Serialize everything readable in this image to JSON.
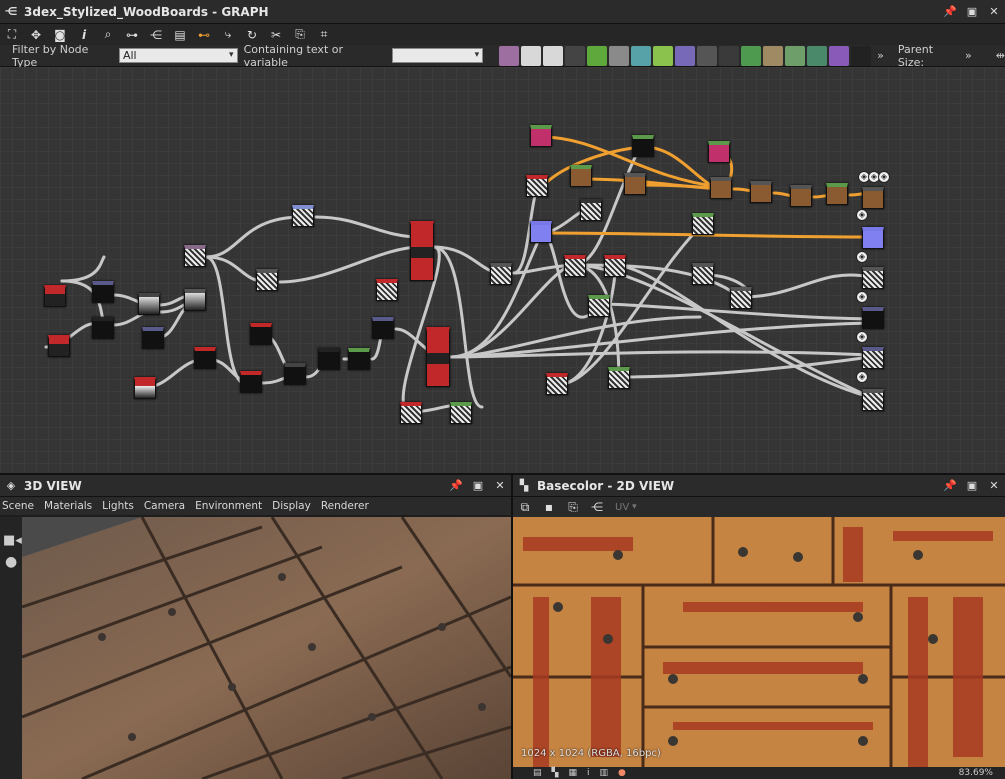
{
  "graph_panel": {
    "title": "3dex_Stylized_WoodBoards - GRAPH",
    "filter_label": "Filter by Node Type",
    "filter_value": "All",
    "containing_label": "Containing text or variable",
    "containing_value": "",
    "parent_size_label": "Parent Size:",
    "overflow_glyph": "»",
    "toolbar_icons": [
      "frame-icon",
      "pan-icon",
      "camera-icon",
      "info-icon",
      "search-icon",
      "link-icon",
      "hierarchy-icon",
      "layers-icon",
      "connect-icon",
      "route-icon",
      "refresh-icon",
      "tools-icon",
      "export-icon",
      "crop-icon"
    ],
    "filter_icons": [
      {
        "name": "image-filter-icon",
        "color": "#9c6fa0"
      },
      {
        "name": "blend-filter-icon",
        "color": "#d8d8d8"
      },
      {
        "name": "levels-filter-icon",
        "color": "#d8d8d8"
      },
      {
        "name": "shuffle-filter-icon",
        "color": "#444444"
      },
      {
        "name": "curve-filter-icon",
        "color": "#5ea83c"
      },
      {
        "name": "color-filter-icon",
        "color": "#8a8a8a"
      },
      {
        "name": "transform-filter-icon",
        "color": "#56a2a8"
      },
      {
        "name": "gradient-filter-icon",
        "color": "#8bc24e"
      },
      {
        "name": "hsl-filter-icon",
        "color": "#7868b8"
      },
      {
        "name": "grid-filter-icon",
        "color": "#555555"
      },
      {
        "name": "output-filter-icon",
        "color": "#3a3a3a"
      },
      {
        "name": "fx-filter-icon",
        "color": "#4e9a4e"
      },
      {
        "name": "normal-filter-icon",
        "color": "#a08a64"
      },
      {
        "name": "hue-filter-icon",
        "color": "#6e9e6a"
      },
      {
        "name": "sharpen-filter-icon",
        "color": "#4a8a6a"
      },
      {
        "name": "spectral-filter-icon",
        "color": "#8a5ab8"
      },
      {
        "name": "noise-filter-icon",
        "color": "#222222"
      }
    ]
  },
  "view3d": {
    "title": "3D VIEW",
    "menu": [
      "Scene",
      "Materials",
      "Lights",
      "Camera",
      "Environment",
      "Display",
      "Renderer"
    ]
  },
  "view2d": {
    "title": "Basecolor - 2D VIEW",
    "uv_label": "UV",
    "resolution_info": "1024 x 1024 (RGBA, 16bpc)",
    "zoom": "83.69%"
  },
  "colors": {
    "accent_orange": "#f0a030",
    "wire": "#c8c8c8",
    "node_red": "#c0282a",
    "node_blue": "#7878e8"
  }
}
